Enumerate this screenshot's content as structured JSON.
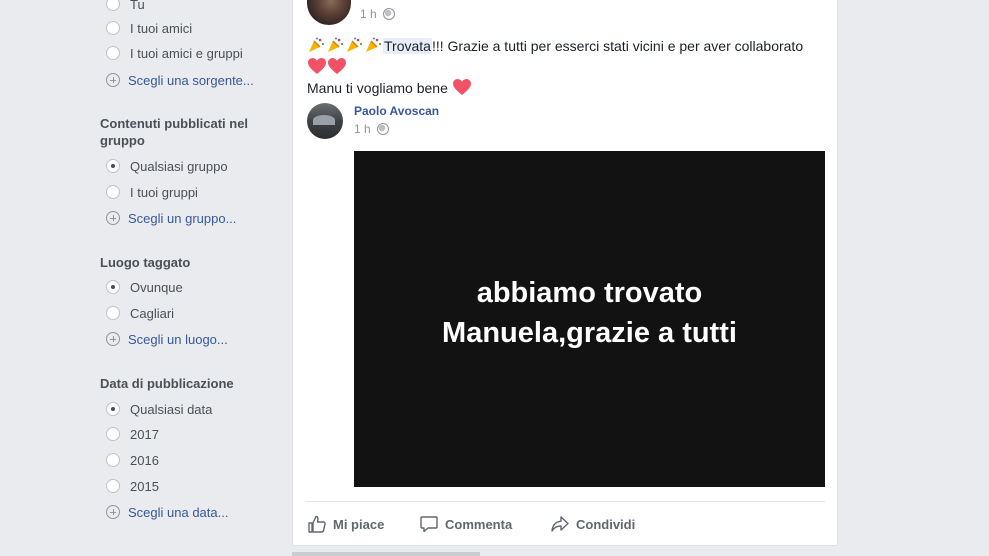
{
  "sidebar": {
    "source_options": [
      {
        "label": "Tu",
        "selected": false
      },
      {
        "label": "I tuoi amici",
        "selected": false
      },
      {
        "label": "I tuoi amici e gruppi",
        "selected": false
      }
    ],
    "source_choose_label": "Scegli una sorgente...",
    "group_heading": "Contenuti pubblicati nel gruppo",
    "group_options": [
      {
        "label": "Qualsiasi gruppo",
        "selected": true
      },
      {
        "label": "I tuoi gruppi",
        "selected": false
      }
    ],
    "group_choose_label": "Scegli un gruppo...",
    "location_heading": "Luogo taggato",
    "location_options": [
      {
        "label": "Ovunque",
        "selected": true
      },
      {
        "label": "Cagliari",
        "selected": false
      }
    ],
    "location_choose_label": "Scegli un luogo...",
    "date_heading": "Data di pubblicazione",
    "date_options": [
      {
        "label": "Qualsiasi data",
        "selected": true
      },
      {
        "label": "2017",
        "selected": false
      },
      {
        "label": "2016",
        "selected": false
      },
      {
        "label": "2015",
        "selected": false
      }
    ],
    "date_choose_label": "Scegli una data..."
  },
  "post": {
    "time": "1 h",
    "hashtag": "Trovata",
    "text_after_hashtag": "!!! Grazie a tutti per esserci stati vicini e per aver collaborato",
    "line2": "Manu ti vogliamo bene",
    "shared": {
      "author": "Paolo Avoscan",
      "time": "1 h",
      "image_line1": "abbiamo trovato",
      "image_line2": "Manuela,grazie a tutti"
    },
    "actions": {
      "like": "Mi piace",
      "comment": "Commenta",
      "share": "Condividi"
    }
  },
  "colors": {
    "link": "#365899",
    "heart": "#f25268",
    "background": "#e9ebee"
  }
}
